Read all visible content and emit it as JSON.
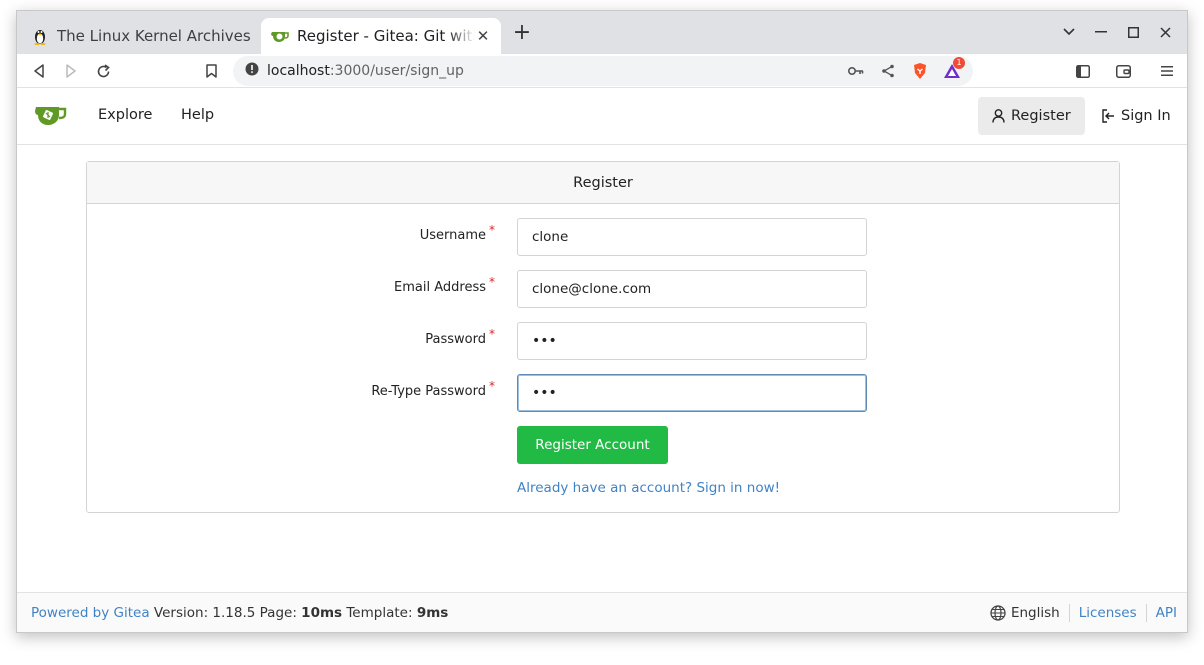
{
  "browser": {
    "tabs": [
      {
        "title": "The Linux Kernel Archives",
        "icon": "tux-penguin-icon",
        "active": false
      },
      {
        "title": "Register - Gitea: Git with a cup of tea",
        "icon": "gitea-teacup-icon",
        "active": true
      }
    ],
    "url_host": "localhost",
    "url_rest": ":3000/user/sign_up",
    "notification_badge": "1"
  },
  "nav": {
    "explore": "Explore",
    "help": "Help",
    "register": "Register",
    "sign_in": "Sign In"
  },
  "form": {
    "heading": "Register",
    "fields": [
      {
        "label": "Username",
        "required": "*",
        "value": "clone",
        "type": "text"
      },
      {
        "label": "Email Address",
        "required": "*",
        "value": "clone@clone.com",
        "type": "text"
      },
      {
        "label": "Password",
        "required": "*",
        "value": "•••",
        "type": "password"
      },
      {
        "label": "Re-Type Password",
        "required": "*",
        "value": "•••",
        "type": "password"
      }
    ],
    "submit_label": "Register Account",
    "signin_link": "Already have an account? Sign in now!"
  },
  "footer": {
    "powered_by": "Powered by Gitea",
    "version_text": "Version: 1.18.5 Page:",
    "page_time": "10ms",
    "template_label": "Template:",
    "template_time": "9ms",
    "language": "English",
    "licenses": "Licenses",
    "api": "API"
  },
  "colors": {
    "primary_green": "#21ba45",
    "link_blue": "#4183c4",
    "required_red": "#db2828"
  }
}
